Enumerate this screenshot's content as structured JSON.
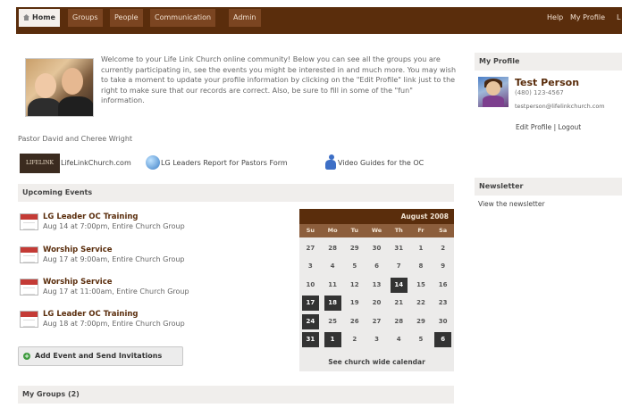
{
  "nav": {
    "tabs": [
      {
        "label": "Home",
        "active": true
      },
      {
        "label": "Groups",
        "active": false
      },
      {
        "label": "People",
        "active": false
      },
      {
        "label": "Communication",
        "active": false
      },
      {
        "label": "Admin",
        "active": false
      }
    ],
    "right_links": [
      "Help",
      "My Profile",
      "L"
    ]
  },
  "intro": {
    "text": "Welcome to your Life Link Church online community! Below you can see all the groups you are currently participating in, see the events you might be interested in and much more. You may wish to take a moment to update your profile information by clicking on the \"Edit Profile\" link just to the right to make sure that our records are correct. Also, be sure to fill in some of the \"fun\" information.",
    "caption": "Pastor David and Cheree Wright"
  },
  "quick_links": [
    {
      "label": "LifeLinkChurch.com",
      "icon": "church-logo-icon",
      "logo_text": "LIFELINK"
    },
    {
      "label": "LG Leaders Report for Pastors Form",
      "icon": "globe-icon"
    },
    {
      "label": "Video Guides for the OC",
      "icon": "person-icon"
    }
  ],
  "events": {
    "header": "Upcoming Events",
    "items": [
      {
        "title": "LG Leader OC Training",
        "when": "Aug 14 at 7:00pm, Entire Church Group"
      },
      {
        "title": "Worship Service",
        "when": "Aug 17 at 9:00am, Entire Church Group"
      },
      {
        "title": "Worship Service",
        "when": "Aug 17 at 11:00am, Entire Church Group"
      },
      {
        "title": "LG Leader OC Training",
        "when": "Aug 18 at 7:00pm, Entire Church Group"
      }
    ],
    "add_button": "Add Event and Send Invitations"
  },
  "calendar": {
    "title": "August 2008",
    "weekdays": [
      "Su",
      "Mo",
      "Tu",
      "We",
      "Th",
      "Fr",
      "Sa"
    ],
    "weeks": [
      [
        {
          "d": "27"
        },
        {
          "d": "28"
        },
        {
          "d": "29"
        },
        {
          "d": "30"
        },
        {
          "d": "31"
        },
        {
          "d": "1"
        },
        {
          "d": "2"
        }
      ],
      [
        {
          "d": "3"
        },
        {
          "d": "4"
        },
        {
          "d": "5"
        },
        {
          "d": "6"
        },
        {
          "d": "7"
        },
        {
          "d": "8"
        },
        {
          "d": "9"
        }
      ],
      [
        {
          "d": "10"
        },
        {
          "d": "11"
        },
        {
          "d": "12"
        },
        {
          "d": "13"
        },
        {
          "d": "14",
          "hl": true
        },
        {
          "d": "15"
        },
        {
          "d": "16"
        }
      ],
      [
        {
          "d": "17",
          "hl": true
        },
        {
          "d": "18",
          "hl": true
        },
        {
          "d": "19"
        },
        {
          "d": "20"
        },
        {
          "d": "21"
        },
        {
          "d": "22"
        },
        {
          "d": "23"
        }
      ],
      [
        {
          "d": "24",
          "hl": true
        },
        {
          "d": "25"
        },
        {
          "d": "26"
        },
        {
          "d": "27"
        },
        {
          "d": "28"
        },
        {
          "d": "29"
        },
        {
          "d": "30"
        }
      ],
      [
        {
          "d": "31",
          "hl": true
        },
        {
          "d": "1",
          "hl": true
        },
        {
          "d": "2"
        },
        {
          "d": "3"
        },
        {
          "d": "4"
        },
        {
          "d": "5"
        },
        {
          "d": "6",
          "hl": true
        }
      ]
    ],
    "footer_link": "See church wide calendar"
  },
  "groups": {
    "header": "My Groups (2)"
  },
  "profile": {
    "header": "My Profile",
    "name": "Test Person",
    "phone": "(480) 123-4567",
    "email": "testperson@lifelinkchurch.com",
    "edit_link": "Edit Profile",
    "separator": "|",
    "logout_link": "Logout"
  },
  "newsletter": {
    "header": "Newsletter",
    "link": "View the newsletter"
  },
  "colors": {
    "brand": "#5a2d0c",
    "calendar_header": "#8c5e3c",
    "highlight": "#333333"
  }
}
